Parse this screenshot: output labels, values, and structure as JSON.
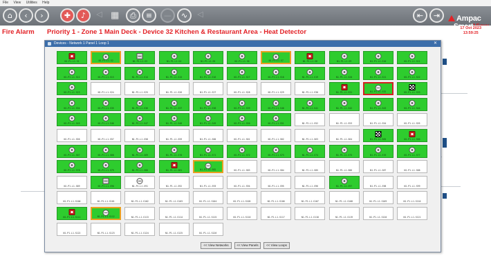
{
  "menu": [
    "File",
    "View",
    "Utilities",
    "Help"
  ],
  "alarm": {
    "type": "Fire Alarm",
    "message": "Priority 1 - Zone 1 Main Deck - Device 32 Kitchen & Restaurant Area - Heat Detector"
  },
  "clock": {
    "date": "17 Oct 2023",
    "time": "13:59:25"
  },
  "logo": {
    "brand": "Ampac",
    "product_a": "Smart",
    "product_b": "View"
  },
  "dialog": {
    "title": "Devices - Network 1 Panel 1 Loop 1"
  },
  "colors": {
    "active": "#2ecc2e",
    "selected_outline": "#e8a020",
    "alarm_outline": "#d32020",
    "alarm_text": "#e32227"
  },
  "rows": [
    [
      {
        "l": "N1.P1.L1.S1",
        "s": "g",
        "i": "mcp"
      },
      {
        "l": "N1.P1.L1.S2",
        "s": "g",
        "i": "smoke",
        "o": "sel"
      },
      {
        "l": "N1.P1.L1.S3",
        "s": "g",
        "i": "module"
      },
      {
        "l": "N1.P1.L1.S4",
        "s": "g",
        "i": "smoke"
      },
      {
        "l": "N1.P1.L1.S5",
        "s": "g",
        "i": "smoke"
      },
      {
        "l": "N1.P1.L1.S6",
        "s": "g",
        "i": "smoke"
      },
      {
        "l": "N1.P1.L1.S7",
        "s": "g",
        "i": "smoke",
        "o": "sel"
      },
      {
        "l": "N1.P1.L1.S8",
        "s": "g",
        "i": "mcp"
      },
      {
        "l": "N1.P1.L1.S9",
        "s": "g",
        "i": "smoke"
      },
      {
        "l": "N1.P1.L1.S10",
        "s": "g",
        "i": "smoke"
      },
      {
        "l": "N1.P1.L1.S11",
        "s": "g",
        "i": "smoke"
      }
    ],
    [
      {
        "l": "N1.P1.L1.S12",
        "s": "g",
        "i": "smoke"
      },
      {
        "l": "N1.P1.L1.S13",
        "s": "g",
        "i": "smoke"
      },
      {
        "l": "N1.P1.L1.S14",
        "s": "g",
        "i": "smoke"
      },
      {
        "l": "N1.P1.L1.S15",
        "s": "g",
        "i": "smoke"
      },
      {
        "l": "N1.P1.L1.S16",
        "s": "g",
        "i": "smoke"
      },
      {
        "l": "N1.P1.L1.S17",
        "s": "g",
        "i": "smoke"
      },
      {
        "l": "N1.P1.L1.S18",
        "s": "g",
        "i": "smoke"
      },
      {
        "l": "N1.P1.L1.S19",
        "s": "g",
        "i": "smoke"
      },
      {
        "l": "N1.P1.L1.S20",
        "s": "g",
        "i": "smoke"
      },
      {
        "l": "N1.P1.L1.S21",
        "s": "g",
        "i": "smoke"
      },
      {
        "l": "N1.P1.L1.S22",
        "s": "g",
        "i": "smoke"
      }
    ],
    [
      {
        "l": "N1.P1.L1.S23",
        "s": "g",
        "i": "smoke"
      },
      {
        "l": "N1.P1.L1.S24",
        "s": "w"
      },
      {
        "l": "N1.P1.L1.S25",
        "s": "w"
      },
      {
        "l": "N1.P1.L1.S26",
        "s": "w"
      },
      {
        "l": "N1.P1.L1.S27",
        "s": "w"
      },
      {
        "l": "N1.P1.L1.S28",
        "s": "w"
      },
      {
        "l": "N1.P1.L1.S29",
        "s": "w"
      },
      {
        "l": "N1.P1.L1.S30",
        "s": "w"
      },
      {
        "l": "N1.P1.L1.S31",
        "s": "g",
        "i": "mcp"
      },
      {
        "l": "N1.P1.L1.S32",
        "s": "g",
        "i": "heat",
        "o": "red"
      },
      {
        "l": "N1.P1.L1.S33",
        "s": "g",
        "i": "checker"
      }
    ],
    [
      {
        "l": "N1.P1.L1.S34",
        "s": "g",
        "i": "smoke"
      },
      {
        "l": "N1.P1.L1.S35",
        "s": "g",
        "i": "smoke"
      },
      {
        "l": "N1.P1.L1.S36",
        "s": "g",
        "i": "smoke"
      },
      {
        "l": "N1.P1.L1.S37",
        "s": "g",
        "i": "smoke"
      },
      {
        "l": "N1.P1.L1.S38",
        "s": "g",
        "i": "smoke"
      },
      {
        "l": "N1.P1.L1.S39",
        "s": "g",
        "i": "smoke"
      },
      {
        "l": "N1.P1.L1.S40",
        "s": "g",
        "i": "smoke"
      },
      {
        "l": "N1.P1.L1.S41",
        "s": "g",
        "i": "smoke"
      },
      {
        "l": "N1.P1.L1.S42",
        "s": "g",
        "i": "smoke"
      },
      {
        "l": "N1.P1.L1.S43",
        "s": "g",
        "i": "smoke"
      },
      {
        "l": "N1.P1.L1.S44",
        "s": "g",
        "i": "smoke"
      }
    ],
    [
      {
        "l": "N1.P1.L1.S45",
        "s": "g",
        "i": "smoke"
      },
      {
        "l": "N1.P1.L1.S46",
        "s": "g",
        "i": "smoke"
      },
      {
        "l": "N1.P1.L1.S47",
        "s": "g",
        "i": "smoke"
      },
      {
        "l": "N1.P1.L1.S48",
        "s": "g",
        "i": "smoke"
      },
      {
        "l": "N1.P1.L1.S49",
        "s": "g",
        "i": "smoke"
      },
      {
        "l": "N1.P1.L1.S50",
        "s": "g",
        "i": "smoke"
      },
      {
        "l": "N1.P1.L1.S51",
        "s": "g",
        "i": "smoke"
      },
      {
        "l": "N1.P1.L1.S52",
        "s": "w"
      },
      {
        "l": "N1.P1.L1.S53",
        "s": "w"
      },
      {
        "l": "N1.P1.L1.S54",
        "s": "w"
      },
      {
        "l": "N1.P1.L1.S55",
        "s": "w"
      }
    ],
    [
      {
        "l": "N1.P1.L1.S56",
        "s": "w"
      },
      {
        "l": "N1.P1.L1.S57",
        "s": "w"
      },
      {
        "l": "N1.P1.L1.S58",
        "s": "w"
      },
      {
        "l": "N1.P1.L1.S59",
        "s": "w"
      },
      {
        "l": "N1.P1.L1.S60",
        "s": "w"
      },
      {
        "l": "N1.P1.L1.S61",
        "s": "w"
      },
      {
        "l": "N1.P1.L1.S62",
        "s": "w"
      },
      {
        "l": "N1.P1.L1.S63",
        "s": "w"
      },
      {
        "l": "N1.P1.L1.S64",
        "s": "w"
      },
      {
        "l": "N1.P1.L1.S65",
        "s": "g",
        "i": "checker"
      },
      {
        "l": "N1.P1.L1.S66",
        "s": "g",
        "i": "mcp"
      }
    ],
    [
      {
        "l": "N1.P1.L1.S67",
        "s": "g",
        "i": "smoke"
      },
      {
        "l": "N1.P1.L1.S68",
        "s": "g",
        "i": "smoke"
      },
      {
        "l": "N1.P1.L1.S69",
        "s": "g",
        "i": "smoke"
      },
      {
        "l": "N1.P1.L1.S70",
        "s": "g",
        "i": "smoke"
      },
      {
        "l": "N1.P1.L1.S71",
        "s": "g",
        "i": "smoke"
      },
      {
        "l": "N1.P1.L1.S72",
        "s": "g",
        "i": "smoke"
      },
      {
        "l": "N1.P1.L1.S73",
        "s": "g",
        "i": "smoke"
      },
      {
        "l": "N1.P1.L1.S74",
        "s": "g",
        "i": "smoke"
      },
      {
        "l": "N1.P1.L1.S75",
        "s": "g",
        "i": "smoke"
      },
      {
        "l": "N1.P1.L1.S76",
        "s": "g",
        "i": "smoke"
      },
      {
        "l": "N1.P1.L1.S77",
        "s": "g",
        "i": "smoke"
      }
    ],
    [
      {
        "l": "N1.P1.L1.S78",
        "s": "g",
        "i": "smoke"
      },
      {
        "l": "N1.P1.L1.S79",
        "s": "g",
        "i": "smoke"
      },
      {
        "l": "N1.P1.L1.S80",
        "s": "g",
        "i": "smoke"
      },
      {
        "l": "N1.P1.L1.S81",
        "s": "g",
        "i": "mcp"
      },
      {
        "l": "N1.P1.L1.S82",
        "s": "g",
        "i": "heat",
        "o": "sel"
      },
      {
        "l": "N1.P1.L1.S83",
        "s": "w"
      },
      {
        "l": "N1.P1.L1.S84",
        "s": "w"
      },
      {
        "l": "N1.P1.L1.S85",
        "s": "w"
      },
      {
        "l": "N1.P1.L1.S86",
        "s": "w"
      },
      {
        "l": "N1.P1.L1.S87",
        "s": "w"
      },
      {
        "l": "N1.P1.L1.S88",
        "s": "w"
      }
    ],
    [
      {
        "l": "N1.P1.L1.S89",
        "s": "w"
      },
      {
        "l": "N1.P1.L1.S90",
        "s": "g",
        "i": "module"
      },
      {
        "l": "N1.P1.L1.S91",
        "s": "w",
        "i": "heat"
      },
      {
        "l": "N1.P1.L1.S92",
        "s": "w"
      },
      {
        "l": "N1.P1.L1.S93",
        "s": "w"
      },
      {
        "l": "N1.P1.L1.S94",
        "s": "w"
      },
      {
        "l": "N1.P1.L1.S95",
        "s": "w"
      },
      {
        "l": "N1.P1.L1.S96",
        "s": "w"
      },
      {
        "l": "N1.P1.L1.S97",
        "s": "g",
        "i": "smoke"
      },
      {
        "l": "N1.P1.L1.S98",
        "s": "w"
      },
      {
        "l": "N1.P1.L1.S99",
        "s": "w"
      }
    ],
    [
      {
        "l": "N1.P1.L1.S100",
        "s": "w"
      },
      {
        "l": "N1.P1.L1.S101",
        "s": "w"
      },
      {
        "l": "N1.P1.L1.S102",
        "s": "w"
      },
      {
        "l": "N1.P1.L1.S103",
        "s": "w"
      },
      {
        "l": "N1.P1.L1.S104",
        "s": "w"
      },
      {
        "l": "N1.P1.L1.S105",
        "s": "w"
      },
      {
        "l": "N1.P1.L1.S106",
        "s": "w"
      },
      {
        "l": "N1.P1.L1.S107",
        "s": "w"
      },
      {
        "l": "N1.P1.L1.S108",
        "s": "w"
      },
      {
        "l": "N1.P1.L1.S109",
        "s": "w"
      },
      {
        "l": "N1.P1.L1.S110",
        "s": "w"
      }
    ],
    [
      {
        "l": "N1.P1.L1.S111",
        "s": "g",
        "i": "mcp"
      },
      {
        "l": "N1.P1.L1.S112",
        "s": "g",
        "i": "heat",
        "o": "sel"
      },
      {
        "l": "N1.P1.L1.S113",
        "s": "w"
      },
      {
        "l": "N1.P1.L1.S114",
        "s": "w"
      },
      {
        "l": "N1.P1.L1.S115",
        "s": "w"
      },
      {
        "l": "N1.P1.L1.S116",
        "s": "w"
      },
      {
        "l": "N1.P1.L1.S117",
        "s": "w"
      },
      {
        "l": "N1.P1.L1.S118",
        "s": "w"
      },
      {
        "l": "N1.P1.L1.S119",
        "s": "w"
      },
      {
        "l": "N1.P1.L1.S120",
        "s": "w"
      },
      {
        "l": "N1.P1.L1.S121",
        "s": "w"
      }
    ],
    [
      {
        "l": "N1.P1.L1.S122",
        "s": "w"
      },
      {
        "l": "N1.P1.L1.S123",
        "s": "w"
      },
      {
        "l": "N1.P1.L1.S124",
        "s": "w"
      },
      {
        "l": "N1.P1.L1.S125",
        "s": "w"
      },
      {
        "l": "N1.P1.L1.S126",
        "s": "w"
      }
    ]
  ],
  "buttons": [
    "<< View Networks",
    "<< View Panels",
    "<< View Loops"
  ]
}
